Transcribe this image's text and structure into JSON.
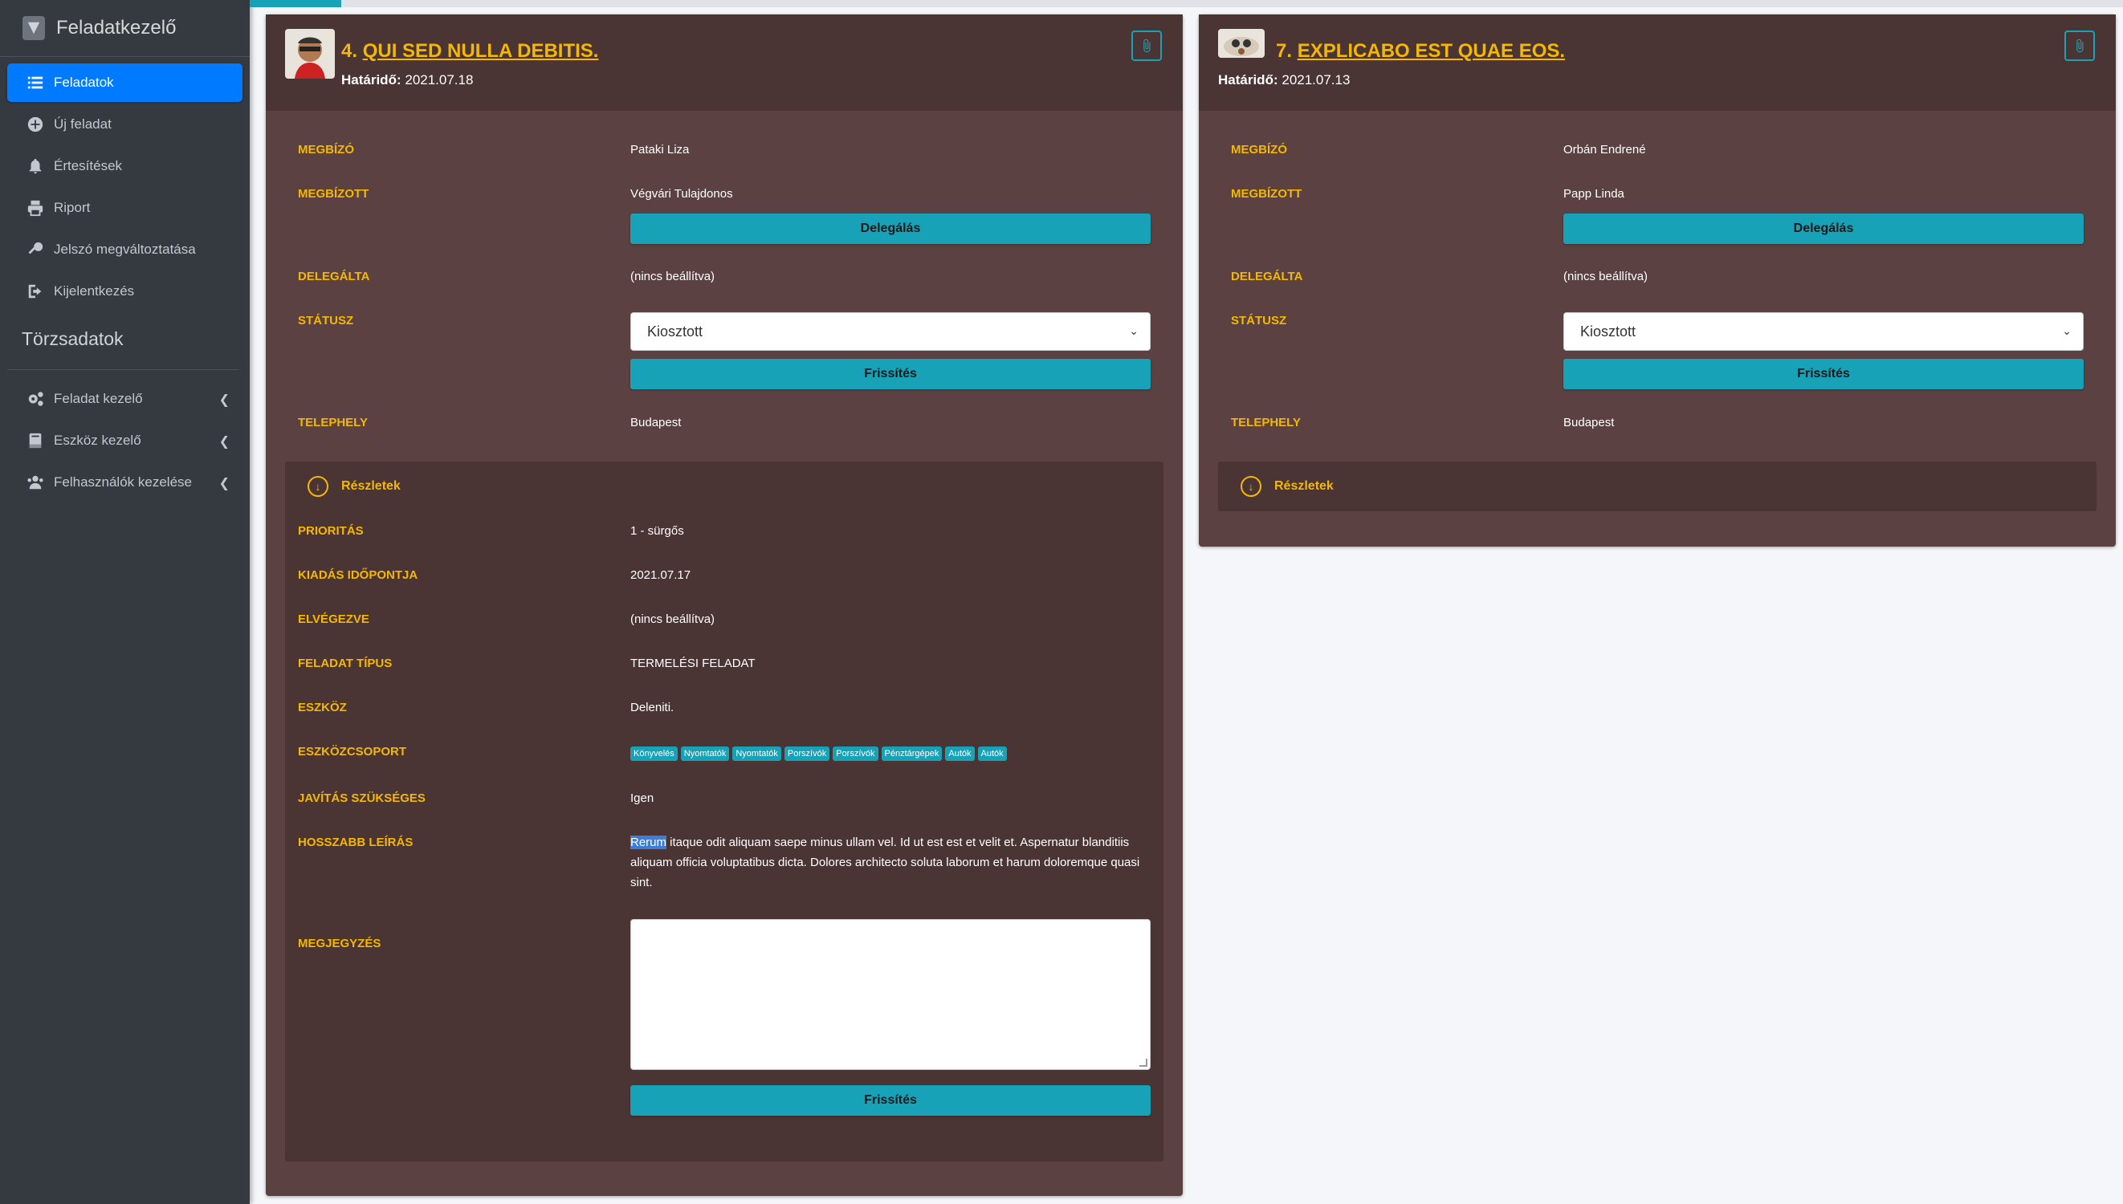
{
  "sidebar": {
    "brand": "Feladatkezelő",
    "items": [
      {
        "label": "Feladatok",
        "icon": "list-icon"
      },
      {
        "label": "Új feladat",
        "icon": "plus-circle-icon"
      },
      {
        "label": "Értesítések",
        "icon": "bell-icon"
      },
      {
        "label": "Riport",
        "icon": "print-icon"
      },
      {
        "label": "Jelszó megváltoztatása",
        "icon": "key-icon"
      },
      {
        "label": "Kijelentkezés",
        "icon": "logout-icon"
      }
    ],
    "section_header": "Törzsadatok",
    "master_items": [
      {
        "label": "Feladat kezelő",
        "icon": "cogs-icon"
      },
      {
        "label": "Eszköz kezelő",
        "icon": "book-icon"
      },
      {
        "label": "Felhasználók kezelése",
        "icon": "users-icon"
      }
    ]
  },
  "colors": {
    "accent": "#f5b800",
    "button": "#17a2b8",
    "card": "#5b4141",
    "card_dark": "#4a3434",
    "active_nav": "#007bff"
  },
  "labels": {
    "megbizo": "MEGBÍZÓ",
    "megbizott": "MEGBÍZOTT",
    "delegalta": "DELEGÁLTA",
    "statusz": "STÁTUSZ",
    "telephely": "TELEPHELY",
    "prioritas": "PRIORITÁS",
    "kiadas": "KIADÁS IDŐPONTJA",
    "elvegezve": "ELVÉGEZVE",
    "tipus": "FELADAT TÍPUS",
    "eszkoz": "ESZKÖZ",
    "eszkozcsoport": "ESZKÖZCSOPORT",
    "javitas": "JAVÍTÁS SZÜKSÉGES",
    "leiras": "HOSSZABB LEÍRÁS",
    "megjegyzes": "MEGJEGYZÉS",
    "delegalas_btn": "Delegálás",
    "frissites_btn": "Frissítés",
    "reszletek": "Részletek",
    "hatarido": "Határidő:"
  },
  "tasks": [
    {
      "number": "4.",
      "title": "QUI SED NULLA DEBITIS.",
      "due": "2021.07.18",
      "megbizo": "Pataki Liza",
      "megbizott": "Végvári Tulajdonos",
      "delegalta": "(nincs beállítva)",
      "status": "Kiosztott",
      "telephely": "Budapest",
      "prioritas": "1 - sürgős",
      "kiadas": "2021.07.17",
      "elvegezve": "(nincs beállítva)",
      "tipus": "TERMELÉSI FELADAT",
      "eszkoz": "Deleniti.",
      "eszkozcsoport": [
        "Könyvelés",
        "Nyomtatók",
        "Nyomtatók",
        "Porszívók",
        "Porszívók",
        "Pénztárgépek",
        "Autók",
        "Autók"
      ],
      "javitas": "Igen",
      "leiras_selected": "Rerum",
      "leiras_rest": " itaque odit aliquam saepe minus ullam vel. Id ut est est et velit et. Aspernatur blanditiis aliquam officia voluptatibus dicta. Dolores architecto soluta laborum et harum doloremque quasi sint."
    },
    {
      "number": "7.",
      "title": "EXPLICABO EST QUAE EOS.",
      "due": "2021.07.13",
      "megbizo": "Orbán Endrené",
      "megbizott": "Papp Linda",
      "delegalta": "(nincs beállítva)",
      "status": "Kiosztott",
      "telephely": "Budapest"
    }
  ]
}
